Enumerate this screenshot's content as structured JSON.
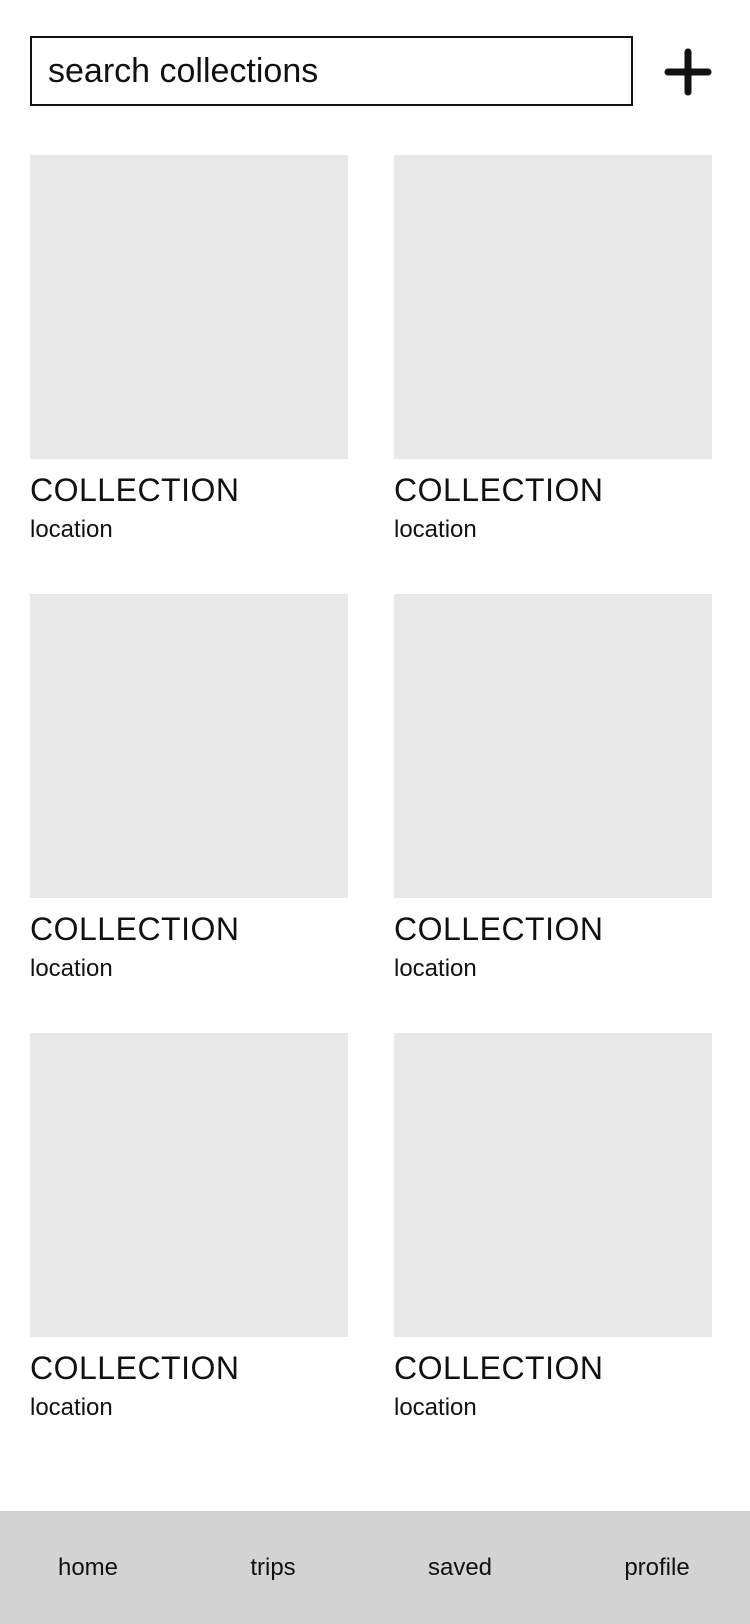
{
  "search": {
    "placeholder": "search collections",
    "value": ""
  },
  "toolbar": {
    "add_icon": "plus-icon"
  },
  "collections": [
    {
      "title": "COLLECTION",
      "location": "location"
    },
    {
      "title": "COLLECTION",
      "location": "location"
    },
    {
      "title": "COLLECTION",
      "location": "location"
    },
    {
      "title": "COLLECTION",
      "location": "location"
    },
    {
      "title": "COLLECTION",
      "location": "location"
    },
    {
      "title": "COLLECTION",
      "location": "location"
    }
  ],
  "nav": {
    "items": [
      {
        "label": "home"
      },
      {
        "label": "trips"
      },
      {
        "label": "saved"
      },
      {
        "label": "profile"
      }
    ]
  },
  "colors": {
    "placeholder_image": "#e8e8e8",
    "nav_background": "#d3d3d3",
    "text": "#111111"
  }
}
